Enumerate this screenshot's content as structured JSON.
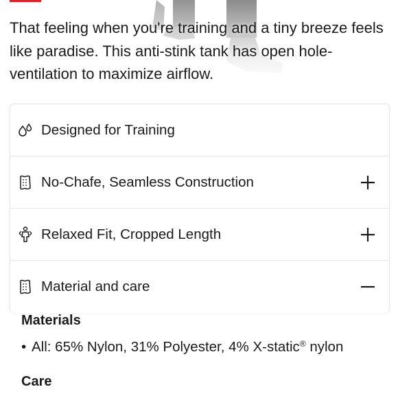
{
  "colors": {
    "accent": "#d8232a",
    "text": "#1a1a1a",
    "border": "#e4e4e4"
  },
  "description": "That feeling when you're training and a tiny breeze feels like paradise. This anti-stink tank has open hole-ventilation to maximize airflow.",
  "accordion": {
    "items": [
      {
        "icon": "droplets-icon",
        "title": "Designed for Training",
        "toggle": ""
      },
      {
        "icon": "fabric-swatch-icon",
        "title": "No-Chafe, Seamless Construction",
        "toggle": "plus"
      },
      {
        "icon": "person-fit-icon",
        "title": "Relaxed Fit, Cropped Length",
        "toggle": "plus"
      },
      {
        "icon": "fabric-swatch-icon",
        "title": "Material and care",
        "toggle": "minus"
      }
    ],
    "material_care": {
      "materials_heading": "Materials",
      "materials": [
        {
          "text_before": "All: 65% Nylon, 31% Polyester, 4% X-static",
          "mark": "®",
          "text_after": " nylon"
        }
      ],
      "care_heading": "Care"
    }
  }
}
